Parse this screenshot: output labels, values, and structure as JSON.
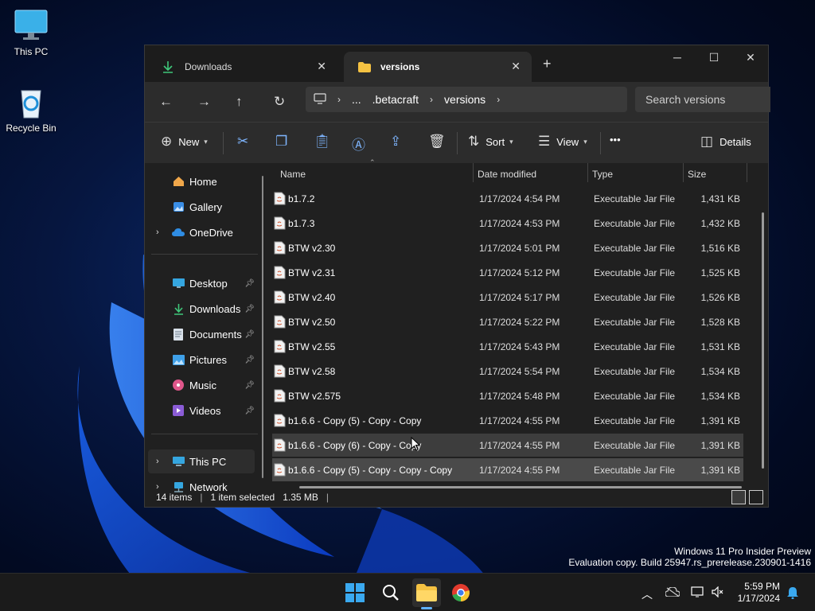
{
  "desktop": {
    "icons": [
      {
        "label": "This PC"
      },
      {
        "label": "Recycle Bin"
      }
    ],
    "watermark": {
      "line1": "Windows 11 Pro Insider Preview",
      "line2": "Evaluation copy. Build 25947.rs_prerelease.230901-1416"
    }
  },
  "window": {
    "tabs": [
      {
        "label": "Downloads",
        "icon": "download-icon"
      },
      {
        "label": "versions",
        "icon": "folder-icon"
      }
    ],
    "new_tab": "+",
    "breadcrumb": {
      "items": [
        "...",
        ".betacraft",
        "versions"
      ]
    },
    "search_placeholder": "Search versions",
    "commands": {
      "new": "New",
      "sort": "Sort",
      "view": "View",
      "more": "•••",
      "details": "Details"
    },
    "sidebar": {
      "quick": [
        {
          "label": "Home"
        },
        {
          "label": "Gallery"
        },
        {
          "label": "OneDrive"
        }
      ],
      "pinned": [
        {
          "label": "Desktop"
        },
        {
          "label": "Downloads"
        },
        {
          "label": "Documents"
        },
        {
          "label": "Pictures"
        },
        {
          "label": "Music"
        },
        {
          "label": "Videos"
        }
      ],
      "devices": [
        {
          "label": "This PC"
        },
        {
          "label": "Network"
        }
      ]
    },
    "columns": {
      "name": "Name",
      "date": "Date modified",
      "type": "Type",
      "size": "Size"
    },
    "files": [
      {
        "name": "b1.7.2",
        "date": "1/17/2024 4:54 PM",
        "type": "Executable Jar File",
        "size": "1,431 KB"
      },
      {
        "name": "b1.7.3",
        "date": "1/17/2024 4:53 PM",
        "type": "Executable Jar File",
        "size": "1,432 KB"
      },
      {
        "name": "BTW v2.30",
        "date": "1/17/2024 5:01 PM",
        "type": "Executable Jar File",
        "size": "1,516 KB"
      },
      {
        "name": "BTW v2.31",
        "date": "1/17/2024 5:12 PM",
        "type": "Executable Jar File",
        "size": "1,525 KB"
      },
      {
        "name": "BTW v2.40",
        "date": "1/17/2024 5:17 PM",
        "type": "Executable Jar File",
        "size": "1,526 KB"
      },
      {
        "name": "BTW v2.50",
        "date": "1/17/2024 5:22 PM",
        "type": "Executable Jar File",
        "size": "1,528 KB"
      },
      {
        "name": "BTW v2.55",
        "date": "1/17/2024 5:43 PM",
        "type": "Executable Jar File",
        "size": "1,531 KB"
      },
      {
        "name": "BTW v2.58",
        "date": "1/17/2024 5:54 PM",
        "type": "Executable Jar File",
        "size": "1,534 KB"
      },
      {
        "name": "BTW v2.575",
        "date": "1/17/2024 5:48 PM",
        "type": "Executable Jar File",
        "size": "1,534 KB"
      },
      {
        "name": "b1.6.6 - Copy (5) - Copy - Copy",
        "date": "1/17/2024 4:55 PM",
        "type": "Executable Jar File",
        "size": "1,391 KB"
      },
      {
        "name": "b1.6.6 - Copy (6) - Copy - Copy",
        "date": "1/17/2024 4:55 PM",
        "type": "Executable Jar File",
        "size": "1,391 KB"
      },
      {
        "name": "b1.6.6 - Copy (5) - Copy - Copy - Copy",
        "date": "1/17/2024 4:55 PM",
        "type": "Executable Jar File",
        "size": "1,391 KB"
      }
    ],
    "status": {
      "count": "14 items",
      "selected": "1 item selected",
      "size": "1.35 MB"
    }
  },
  "taskbar": {
    "time": "5:59 PM",
    "date": "1/17/2024"
  },
  "colors": {
    "accent": "#5fb2ff",
    "window_bg": "#202020",
    "toolbar_bg": "#2c2c2c"
  }
}
